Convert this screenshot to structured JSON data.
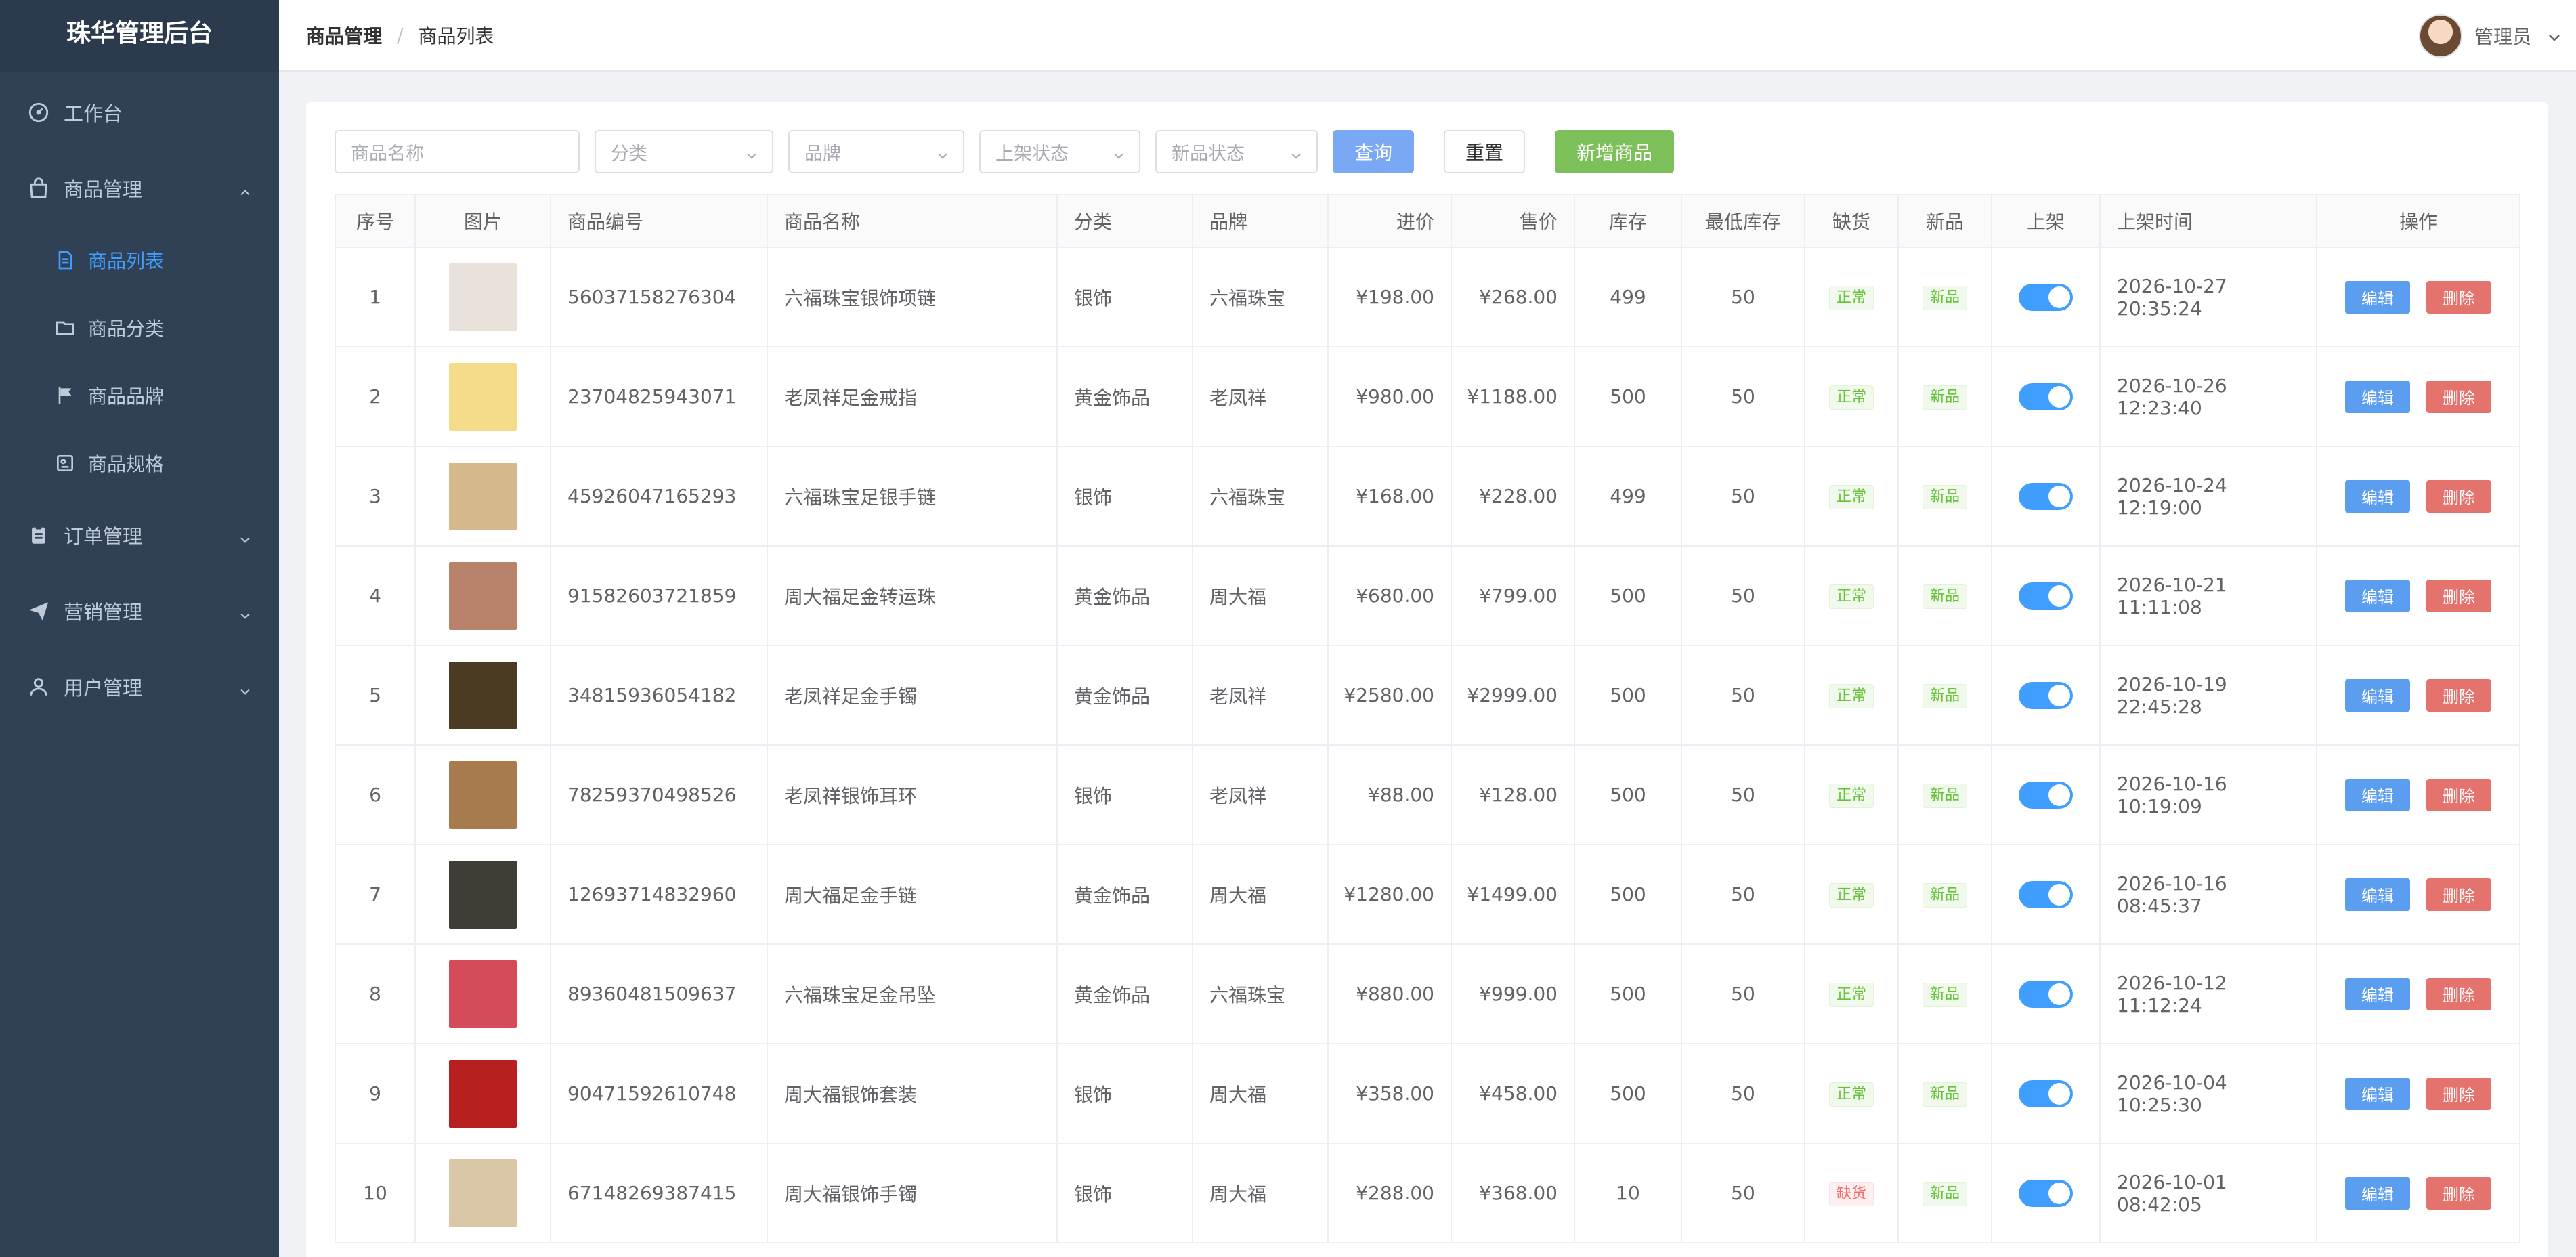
{
  "app": {
    "title": "珠华管理后台"
  },
  "sidebar": {
    "items": [
      {
        "label": "工作台",
        "icon": "dashboard-icon"
      },
      {
        "label": "商品管理",
        "icon": "shopping-bag-icon",
        "expanded": true,
        "children": [
          {
            "label": "商品列表",
            "icon": "document-icon",
            "active": true
          },
          {
            "label": "商品分类",
            "icon": "folder-icon"
          },
          {
            "label": "商品品牌",
            "icon": "flag-icon"
          },
          {
            "label": "商品规格",
            "icon": "tag-box-icon"
          }
        ]
      },
      {
        "label": "订单管理",
        "icon": "clipboard-icon"
      },
      {
        "label": "营销管理",
        "icon": "send-icon"
      },
      {
        "label": "用户管理",
        "icon": "user-icon"
      }
    ]
  },
  "header": {
    "breadcrumb": [
      "商品管理",
      "商品列表"
    ],
    "separator": "/",
    "user": "管理员"
  },
  "filters": {
    "name_placeholder": "商品名称",
    "category_placeholder": "分类",
    "brand_placeholder": "品牌",
    "status_placeholder": "上架状态",
    "new_placeholder": "新品状态",
    "query_label": "查询",
    "reset_label": "重置",
    "add_label": "新增商品"
  },
  "table": {
    "headers": [
      "序号",
      "图片",
      "商品编号",
      "商品名称",
      "分类",
      "品牌",
      "进价",
      "售价",
      "库存",
      "最低库存",
      "缺货",
      "新品",
      "上架",
      "上架时间",
      "操作"
    ],
    "edit_label": "编辑",
    "delete_label": "删除",
    "rows": [
      {
        "no": "1",
        "code": "56037158276304",
        "name": "六福珠宝银饰项链",
        "category": "银饰",
        "brand": "六福珠宝",
        "cost": "¥198.00",
        "price": "¥268.00",
        "stock": "499",
        "min_stock": "50",
        "shortage": "正常",
        "new": "新品",
        "on_shelf": true,
        "time": "2026-10-27 20:35:24",
        "thumb_color": "#e9e2da"
      },
      {
        "no": "2",
        "code": "23704825943071",
        "name": "老凤祥足金戒指",
        "category": "黄金饰品",
        "brand": "老凤祥",
        "cost": "¥980.00",
        "price": "¥1188.00",
        "stock": "500",
        "min_stock": "50",
        "shortage": "正常",
        "new": "新品",
        "on_shelf": true,
        "time": "2026-10-26 12:23:40",
        "thumb_color": "#f4dc8a"
      },
      {
        "no": "3",
        "code": "45926047165293",
        "name": "六福珠宝足银手链",
        "category": "银饰",
        "brand": "六福珠宝",
        "cost": "¥168.00",
        "price": "¥228.00",
        "stock": "499",
        "min_stock": "50",
        "shortage": "正常",
        "new": "新品",
        "on_shelf": true,
        "time": "2026-10-24 12:19:00",
        "thumb_color": "#d6b98a"
      },
      {
        "no": "4",
        "code": "91582603721859",
        "name": "周大福足金转运珠",
        "category": "黄金饰品",
        "brand": "周大福",
        "cost": "¥680.00",
        "price": "¥799.00",
        "stock": "500",
        "min_stock": "50",
        "shortage": "正常",
        "new": "新品",
        "on_shelf": true,
        "time": "2026-10-21 11:11:08",
        "thumb_color": "#b9826a"
      },
      {
        "no": "5",
        "code": "34815936054182",
        "name": "老凤祥足金手镯",
        "category": "黄金饰品",
        "brand": "老凤祥",
        "cost": "¥2580.00",
        "price": "¥2999.00",
        "stock": "500",
        "min_stock": "50",
        "shortage": "正常",
        "new": "新品",
        "on_shelf": true,
        "time": "2026-10-19 22:45:28",
        "thumb_color": "#4b3b22"
      },
      {
        "no": "6",
        "code": "78259370498526",
        "name": "老凤祥银饰耳环",
        "category": "银饰",
        "brand": "老凤祥",
        "cost": "¥88.00",
        "price": "¥128.00",
        "stock": "500",
        "min_stock": "50",
        "shortage": "正常",
        "new": "新品",
        "on_shelf": true,
        "time": "2026-10-16 10:19:09",
        "thumb_color": "#a77b4e"
      },
      {
        "no": "7",
        "code": "12693714832960",
        "name": "周大福足金手链",
        "category": "黄金饰品",
        "brand": "周大福",
        "cost": "¥1280.00",
        "price": "¥1499.00",
        "stock": "500",
        "min_stock": "50",
        "shortage": "正常",
        "new": "新品",
        "on_shelf": true,
        "time": "2026-10-16 08:45:37",
        "thumb_color": "#3e3e36"
      },
      {
        "no": "8",
        "code": "89360481509637",
        "name": "六福珠宝足金吊坠",
        "category": "黄金饰品",
        "brand": "六福珠宝",
        "cost": "¥880.00",
        "price": "¥999.00",
        "stock": "500",
        "min_stock": "50",
        "shortage": "正常",
        "new": "新品",
        "on_shelf": true,
        "time": "2026-10-12 11:12:24",
        "thumb_color": "#d64b5a"
      },
      {
        "no": "9",
        "code": "90471592610748",
        "name": "周大福银饰套装",
        "category": "银饰",
        "brand": "周大福",
        "cost": "¥358.00",
        "price": "¥458.00",
        "stock": "500",
        "min_stock": "50",
        "shortage": "正常",
        "new": "新品",
        "on_shelf": true,
        "time": "2026-10-04 10:25:30",
        "thumb_color": "#b81f1f"
      },
      {
        "no": "10",
        "code": "67148269387415",
        "name": "周大福银饰手镯",
        "category": "银饰",
        "brand": "周大福",
        "cost": "¥288.00",
        "price": "¥368.00",
        "stock": "10",
        "min_stock": "50",
        "shortage": "缺货",
        "new": "新品",
        "on_shelf": true,
        "time": "2026-10-01 08:42:05",
        "thumb_color": "#d9c7a8"
      }
    ]
  }
}
